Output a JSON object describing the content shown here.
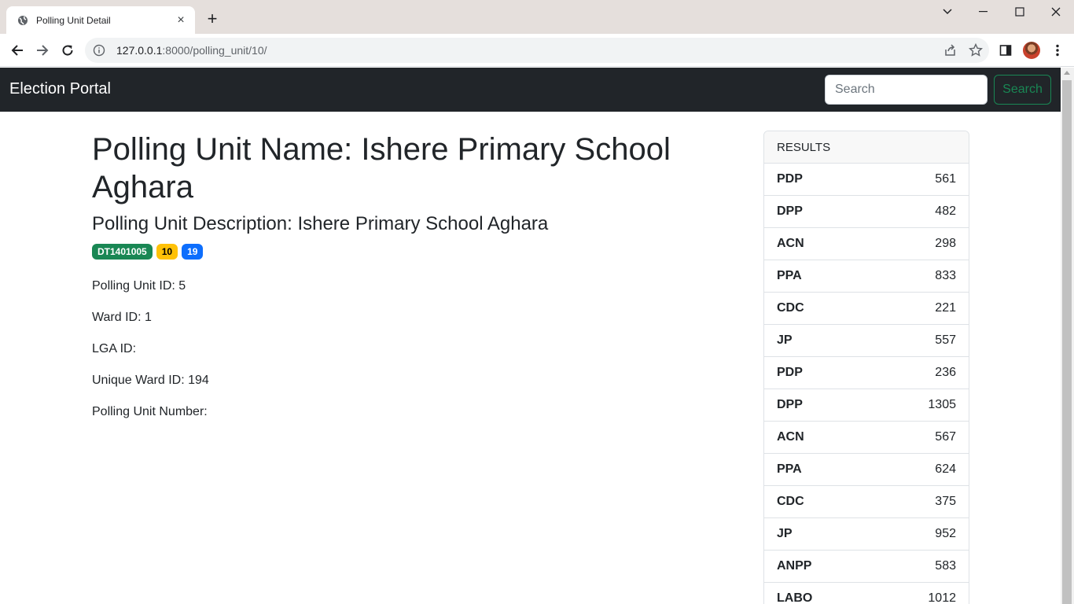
{
  "browser": {
    "tab_title": "Polling Unit Detail",
    "url_host": "127.0.0.1",
    "url_path": ":8000/polling_unit/10/"
  },
  "navbar": {
    "brand": "Election Portal",
    "search_placeholder": "Search",
    "search_button": "Search"
  },
  "polling_unit": {
    "name_heading": "Polling Unit Name: Ishere Primary School Aghara",
    "description_heading": "Polling Unit Description: Ishere Primary School Aghara",
    "badges": [
      "DT1401005",
      "10",
      "19"
    ],
    "fields": [
      "Polling Unit ID: 5",
      "Ward ID: 1",
      "LGA ID:",
      "Unique Ward ID: 194",
      "Polling Unit Number:"
    ]
  },
  "results": {
    "header": "RESULTS",
    "rows": [
      {
        "party": "PDP",
        "score": "561"
      },
      {
        "party": "DPP",
        "score": "482"
      },
      {
        "party": "ACN",
        "score": "298"
      },
      {
        "party": "PPA",
        "score": "833"
      },
      {
        "party": "CDC",
        "score": "221"
      },
      {
        "party": "JP",
        "score": "557"
      },
      {
        "party": "PDP",
        "score": "236"
      },
      {
        "party": "DPP",
        "score": "1305"
      },
      {
        "party": "ACN",
        "score": "567"
      },
      {
        "party": "PPA",
        "score": "624"
      },
      {
        "party": "CDC",
        "score": "375"
      },
      {
        "party": "JP",
        "score": "952"
      },
      {
        "party": "ANPP",
        "score": "583"
      },
      {
        "party": "LABO",
        "score": "1012"
      }
    ]
  }
}
